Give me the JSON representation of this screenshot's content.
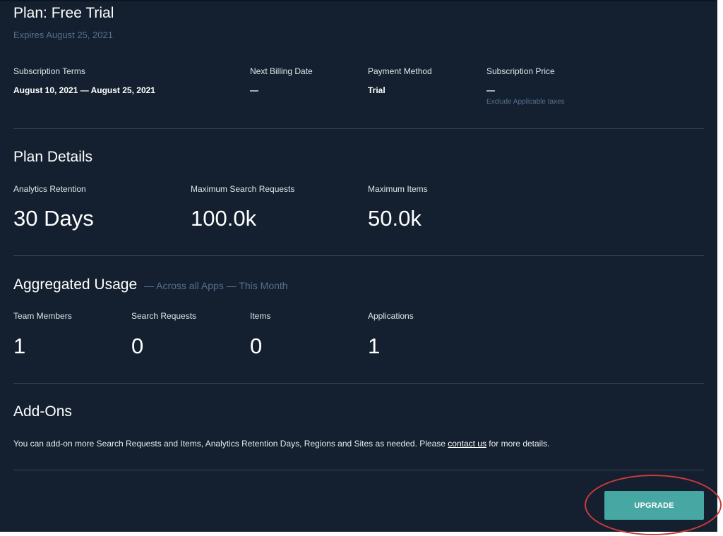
{
  "plan": {
    "title": "Plan: Free Trial",
    "expires": "Expires August 25, 2021"
  },
  "terms": [
    {
      "label": "Subscription Terms",
      "value": "August 10, 2021 — August 25, 2021"
    },
    {
      "label": "Next Billing Date",
      "value": "—"
    },
    {
      "label": "Payment Method",
      "value": "Trial"
    },
    {
      "label": "Subscription Price",
      "value": "—",
      "note": "Exclude Applicable taxes"
    }
  ],
  "plan_details": {
    "title": "Plan Details",
    "stats": [
      {
        "label": "Analytics Retention",
        "value": "30 Days"
      },
      {
        "label": "Maximum Search Requests",
        "value": "100.0k"
      },
      {
        "label": "Maximum Items",
        "value": "50.0k"
      }
    ]
  },
  "usage": {
    "title": "Aggregated Usage",
    "subtitle": "— Across all Apps — This Month",
    "stats": [
      {
        "label": "Team Members",
        "value": "1"
      },
      {
        "label": "Search Requests",
        "value": "0"
      },
      {
        "label": "Items",
        "value": "0"
      },
      {
        "label": "Applications",
        "value": "1"
      }
    ]
  },
  "addons": {
    "title": "Add-Ons",
    "text_before": "You can add-on more Search Requests and Items, Analytics Retention Days, Regions and Sites as needed. Please ",
    "link": "contact us",
    "text_after": " for more details."
  },
  "actions": {
    "upgrade_label": "UPGRADE"
  },
  "colors": {
    "background": "#14202f",
    "accent": "#47a7a2",
    "muted_text": "#56708f",
    "highlight": "#cf3a3a"
  }
}
